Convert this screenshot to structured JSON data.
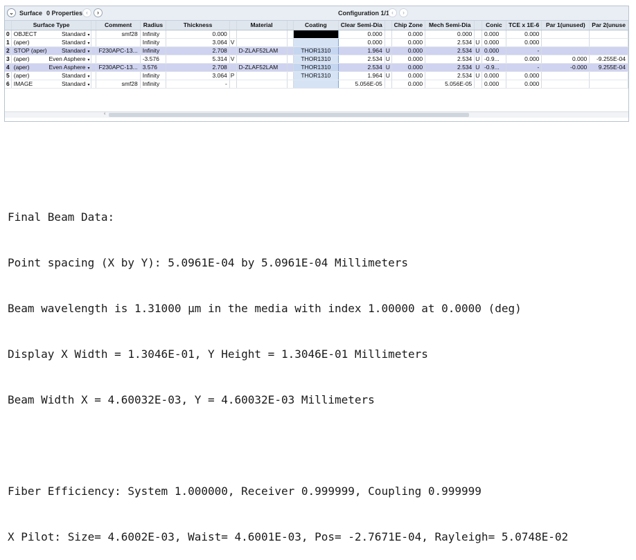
{
  "toolbar": {
    "collapse_glyph": "⌄",
    "surface_label": "Surface",
    "properties_label": "0 Properties",
    "prev_glyph": "‹",
    "next_glyph": "›",
    "configuration_label": "Configuration 1/1"
  },
  "columns": [
    "",
    "Surface Type",
    "",
    "Comment",
    "Radius",
    "Thickness",
    "",
    "Material",
    "",
    "Coating",
    "Clear Semi-Dia",
    "",
    "Chip Zone",
    "Mech Semi-Dia",
    "",
    "Conic",
    "TCE x 1E-6",
    "Par 1(unused)",
    "Par 2(unuse"
  ],
  "rows": [
    {
      "num": "0",
      "name": "OBJECT",
      "type": "Standard",
      "comment": "smf28",
      "radius": "Infinity",
      "thickness": "0.000",
      "tsol": "",
      "material": "",
      "msol": "",
      "coating": "",
      "clear": "0.000",
      "csol": "",
      "chip": "0.000",
      "mech": "0.000",
      "mechsol": "",
      "conic": "0.000",
      "tce": "0.000",
      "par1": "",
      "par2": ""
    },
    {
      "num": "1",
      "name": "(aper)",
      "type": "Standard",
      "comment": "",
      "radius": "Infinity",
      "thickness": "3.064",
      "tsol": "V",
      "material": "",
      "msol": "",
      "coating": "",
      "clear": "0.000",
      "csol": "",
      "chip": "0.000",
      "mech": "2.534",
      "mechsol": "U",
      "conic": "0.000",
      "tce": "0.000",
      "par1": "",
      "par2": ""
    },
    {
      "num": "2",
      "name": "STOP (aper)",
      "type": "Standard",
      "comment": "F230APC-13...",
      "radius": "Infinity",
      "thickness": "2.708",
      "tsol": "",
      "material": "D-ZLAF52LAM",
      "msol": "",
      "coating": "THOR1310",
      "clear": "1.964",
      "csol": "U",
      "chip": "0.000",
      "mech": "2.534",
      "mechsol": "U",
      "conic": "0.000",
      "tce": "-",
      "par1": "",
      "par2": ""
    },
    {
      "num": "3",
      "name": "(aper)",
      "type": "Even Asphere",
      "comment": "",
      "radius": "-3.576",
      "thickness": "5.314",
      "tsol": "V",
      "material": "",
      "msol": "",
      "coating": "THOR1310",
      "clear": "2.534",
      "csol": "U",
      "chip": "0.000",
      "mech": "2.534",
      "mechsol": "U",
      "conic": "-0.9...",
      "tce": "0.000",
      "par1": "0.000",
      "par2": "-9.255E-04"
    },
    {
      "num": "4",
      "name": "(aper)",
      "type": "Even Asphere",
      "comment": "F230APC-13...",
      "radius": "3.576",
      "thickness": "2.708",
      "tsol": "",
      "material": "D-ZLAF52LAM",
      "msol": "",
      "coating": "THOR1310",
      "clear": "2.534",
      "csol": "U",
      "chip": "0.000",
      "mech": "2.534",
      "mechsol": "U",
      "conic": "-0.9...",
      "tce": "-",
      "par1": "-0.000",
      "par2": "9.255E-04"
    },
    {
      "num": "5",
      "name": "(aper)",
      "type": "Standard",
      "comment": "",
      "radius": "Infinity",
      "thickness": "3.064",
      "tsol": "P",
      "material": "",
      "msol": "",
      "coating": "THOR1310",
      "clear": "1.964",
      "csol": "U",
      "chip": "0.000",
      "mech": "2.534",
      "mechsol": "U",
      "conic": "0.000",
      "tce": "0.000",
      "par1": "",
      "par2": ""
    },
    {
      "num": "6",
      "name": "IMAGE",
      "type": "Standard",
      "comment": "smf28",
      "radius": "Infinity",
      "thickness": "-",
      "tsol": "",
      "material": "",
      "msol": "",
      "coating": "",
      "clear": "5.056E-05",
      "csol": "",
      "chip": "0.000",
      "mech": "5.056E-05",
      "mechsol": "",
      "conic": "0.000",
      "tce": "0.000",
      "par1": "",
      "par2": ""
    }
  ],
  "dropdown_glyph": "▾",
  "scroll_arrow": "‹",
  "beam": {
    "heading": "Final Beam Data:",
    "spacing": "Point spacing (X by Y): 5.0961E-04 by 5.0961E-04 Millimeters",
    "wavelength": "Beam wavelength is 1.31000 µm in the media with index 1.00000 at 0.0000 (deg)",
    "display": "Display X Width = 1.3046E-01, Y Height = 1.3046E-01 Millimeters",
    "width": "Beam Width X = 4.60032E-03, Y = 4.60032E-03 Millimeters",
    "efficiency": "Fiber Efficiency: System 1.000000, Receiver 0.999999, Coupling 0.999999",
    "pilot": "X Pilot: Size= 4.6002E-03, Waist= 4.6001E-03, Pos= -2.7671E-04, Rayleigh= 5.0748E-02"
  }
}
